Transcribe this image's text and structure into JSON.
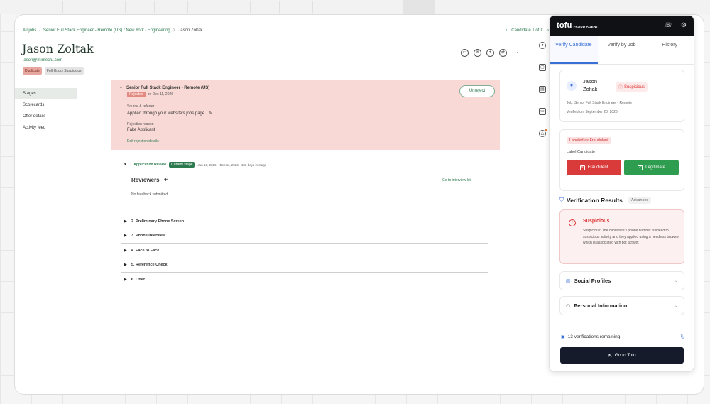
{
  "breadcrumb": {
    "items": [
      "All jobs",
      "Senior Full Stack Engineer - Remote (US) / New York / Engineering",
      "Jason Zoltak"
    ],
    "right": [
      "Candidate 1 of X"
    ]
  },
  "candidate": {
    "name": "Jason Zoltak",
    "email": "jason@mimecfu.com",
    "badges": [
      "Duplicate",
      "Full-Hours Suspicious"
    ]
  },
  "left_nav": [
    "Stages",
    "Scorecards",
    "Offer details",
    "Activity feed"
  ],
  "stage_panel": {
    "job_title": "Senior Full Stack Engineer - Remote (US)",
    "rejected_chip": "Rejected",
    "rejected_date": "on Dec 11, 2026",
    "source_label": "Source & referrer",
    "source_value": "Applied through your website's jobs page",
    "reason_label": "Rejection reason",
    "reason_value": "Fake Applicant",
    "edit_link": "Edit rejection details",
    "unreject_label": "Unreject"
  },
  "app_review": {
    "name": "1. Application Review",
    "chip": "Current stage",
    "meta": "Jun 10, 2026 – Dec 11, 2026  ·  183 days in stage",
    "reviewers_label": "Reviewers",
    "go_interview": "Go to interview kit",
    "no_feedback": "No feedback submitted"
  },
  "stages": [
    "2. Preliminary Phone Screen",
    "3. Phone Interview",
    "4. Face to Face",
    "5. Reference Check",
    "6. Offer"
  ],
  "tofu": {
    "logo": "tofu",
    "sub": "FRAUD AGENT",
    "tabs": [
      "Verify Candidate",
      "Verify by Job",
      "History"
    ],
    "candidate_name": "Jason Zoltak",
    "status_tag": "Suspicious",
    "job_line": "Job: Senior Full Stack Engineer - Remote",
    "verified_line": "Verified on: September 23, 2026",
    "fraud_tag": "Labeled as Fraudulent",
    "label_candidate": "Label Candidate",
    "fraud_btn": "Fraudulent",
    "legit_btn": "Legitimate",
    "vr_title": "Verification Results",
    "vr_adv": "Advanced",
    "result_title": "Suspicious",
    "result_desc": "Suspicious: The candidate's phone number is linked to suspicious activity and they applied using a headless browser which is associated with bot activity.",
    "social_label": "Social Profiles",
    "personal_label": "Personal Information",
    "verif_remaining": "13 verifications remaining",
    "goto_label": "Go to Tofu"
  },
  "colors": {
    "brand_green": "#2d7a4f",
    "reject_bg": "#f8d9d5",
    "tofu_blue": "#3b6fd8",
    "fraud_red": "#d93b3b",
    "legit_green": "#2f9d4f",
    "tofu_dark": "#151b2b"
  }
}
